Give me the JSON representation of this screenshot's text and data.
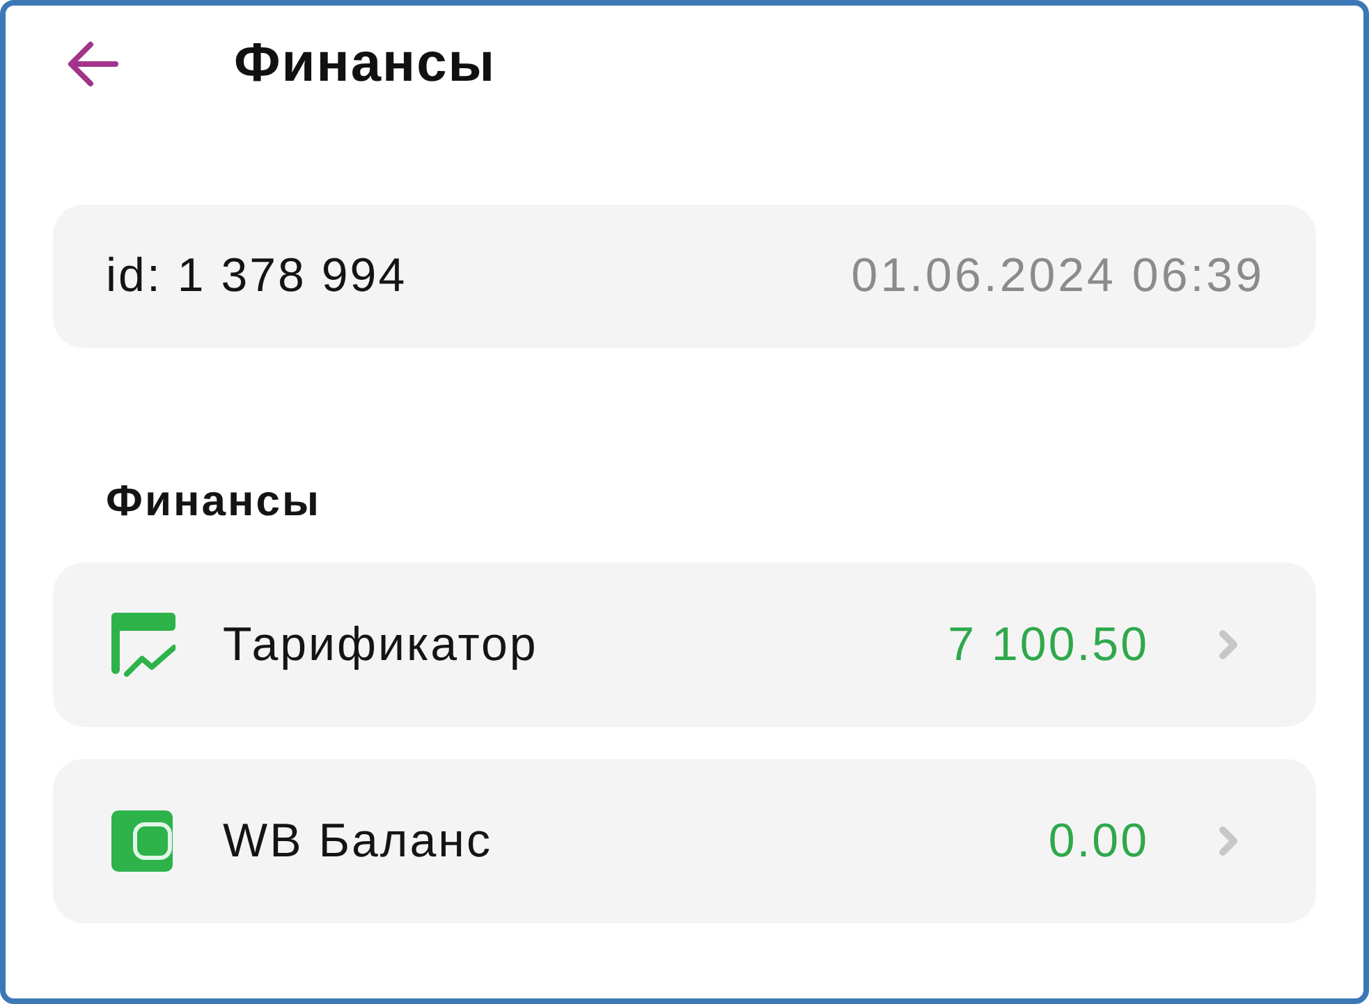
{
  "header": {
    "title": "Финансы"
  },
  "account": {
    "id": "id: 1 378 994",
    "datetime": "01.06.2024 06:39"
  },
  "section": {
    "title": "Финансы"
  },
  "items": [
    {
      "kind": "tariff",
      "label": "Тарификатор",
      "amount": "7 100.50"
    },
    {
      "kind": "wallet",
      "label": "WB Баланс",
      "amount": "0.00"
    }
  ]
}
